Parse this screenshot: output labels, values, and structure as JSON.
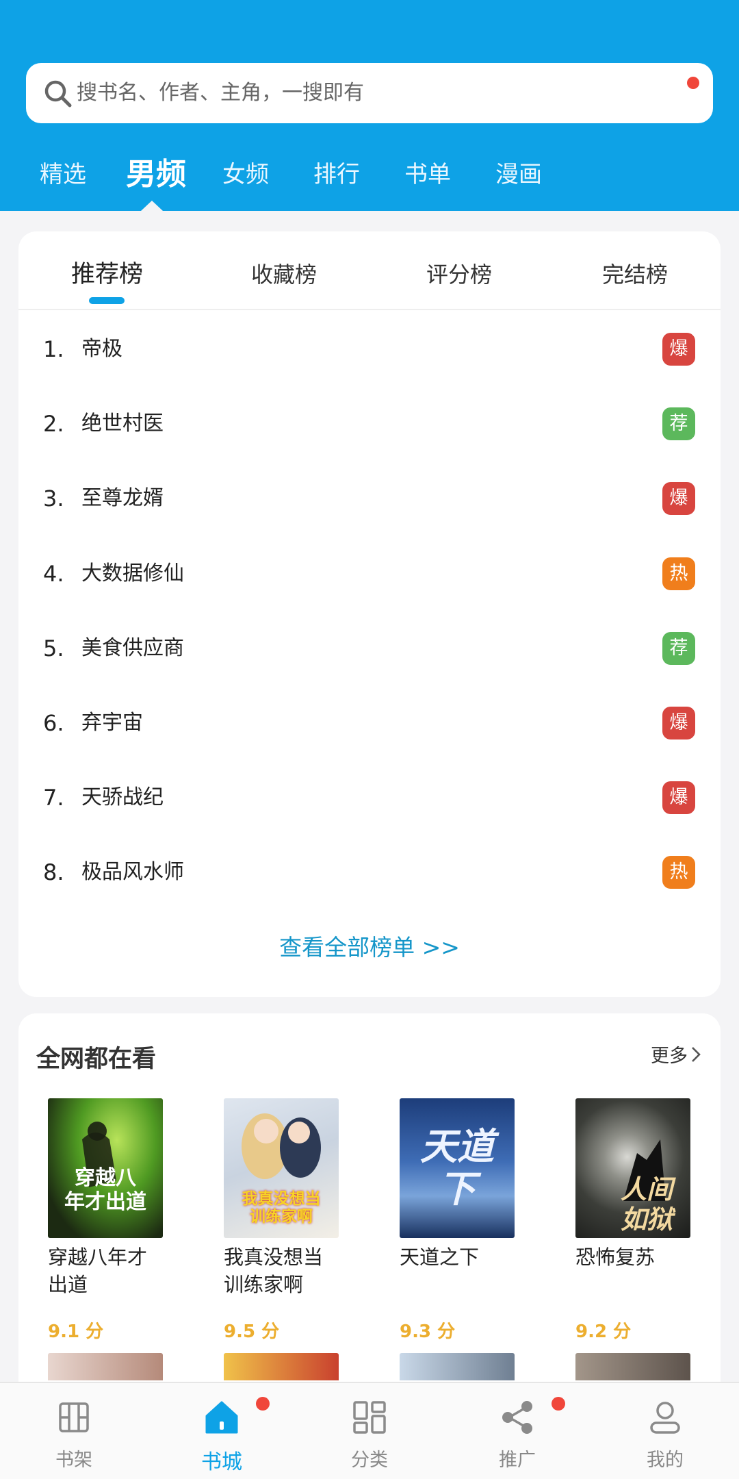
{
  "search": {
    "placeholder": "搜书名、作者、主角，一搜即有"
  },
  "top_tabs": [
    "精选",
    "男频",
    "女频",
    "排行",
    "书单",
    "漫画"
  ],
  "active_top_tab": "男频",
  "rank": {
    "tabs": [
      "推荐榜",
      "收藏榜",
      "评分榜",
      "完结榜"
    ],
    "active_tab": "推荐榜",
    "items": [
      {
        "num": "1.",
        "title": "帝极",
        "badge": "爆",
        "badge_color": "#d8453f"
      },
      {
        "num": "2.",
        "title": "绝世村医",
        "badge": "荐",
        "badge_color": "#5cb85c"
      },
      {
        "num": "3.",
        "title": "至尊龙婿",
        "badge": "爆",
        "badge_color": "#d8453f"
      },
      {
        "num": "4.",
        "title": "大数据修仙",
        "badge": "热",
        "badge_color": "#f07e1c"
      },
      {
        "num": "5.",
        "title": "美食供应商",
        "badge": "荐",
        "badge_color": "#5cb85c"
      },
      {
        "num": "6.",
        "title": "弃宇宙",
        "badge": "爆",
        "badge_color": "#d8453f"
      },
      {
        "num": "7.",
        "title": "天骄战纪",
        "badge": "爆",
        "badge_color": "#d8453f"
      },
      {
        "num": "8.",
        "title": "极品风水师",
        "badge": "热",
        "badge_color": "#f07e1c"
      }
    ],
    "view_all": "查看全部榜单 >>"
  },
  "popular": {
    "title": "全网都在看",
    "more": "更多",
    "books": [
      {
        "title": "穿越八年才出道",
        "score": "9.1 分",
        "cover_text": "穿越八\n年才出道"
      },
      {
        "title": "我真没想当训练家啊",
        "score": "9.5 分",
        "cover_text": "我真没想当\n训练家啊"
      },
      {
        "title": "天道之下",
        "score": "9.3 分",
        "cover_text": "天道\n下"
      },
      {
        "title": "恐怖复苏",
        "score": "9.2 分",
        "cover_text": "人间\n如狱"
      }
    ]
  },
  "bottom_nav": {
    "items": [
      "书架",
      "书城",
      "分类",
      "推广",
      "我的"
    ],
    "active": "书城"
  },
  "colors": {
    "primary": "#0ea2e6",
    "badge_hot_red": "#d8453f",
    "badge_rec_green": "#5cb85c",
    "badge_hot_orange": "#f07e1c",
    "score": "#ecae2f"
  }
}
